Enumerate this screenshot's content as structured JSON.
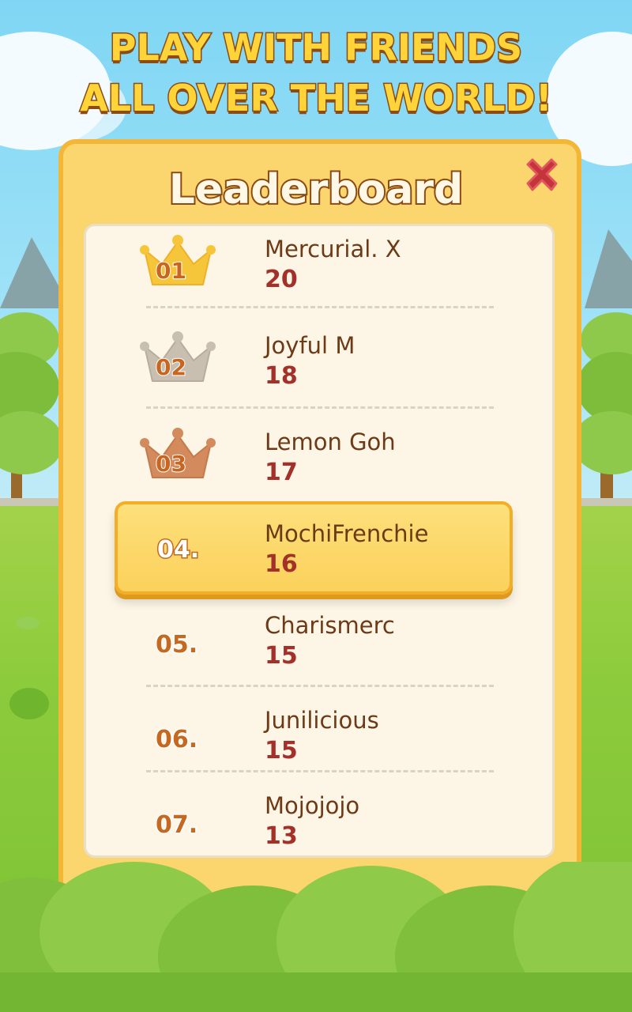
{
  "headline": {
    "line1": "PLAY WITH FRIENDS",
    "line2": "ALL OVER THE WORLD!"
  },
  "panel": {
    "title": "Leaderboard",
    "close_icon": "close-x-icon"
  },
  "leaderboard": [
    {
      "rank": "01",
      "name": "Mercurial. X",
      "score": "20",
      "crown": "gold-crown-icon"
    },
    {
      "rank": "02",
      "name": "Joyful M",
      "score": "18",
      "crown": "silver-crown-icon"
    },
    {
      "rank": "03",
      "name": "Lemon Goh",
      "score": "17",
      "crown": "bronze-crown-icon"
    },
    {
      "rank": "04.",
      "name": "MochiFrenchie",
      "score": "16",
      "highlighted": true
    },
    {
      "rank": "05.",
      "name": "Charismerc",
      "score": "15"
    },
    {
      "rank": "06.",
      "name": "Junilicious",
      "score": "15"
    },
    {
      "rank": "07.",
      "name": "Mojojojo",
      "score": "13"
    }
  ],
  "colors": {
    "gold": "#f6c63a",
    "silver": "#c8bfb1",
    "bronze": "#d38a5c",
    "panel": "#fbd56d",
    "highlight": "#fbd15b",
    "name_text": "#6d3a17",
    "score_text": "#a4302a"
  }
}
